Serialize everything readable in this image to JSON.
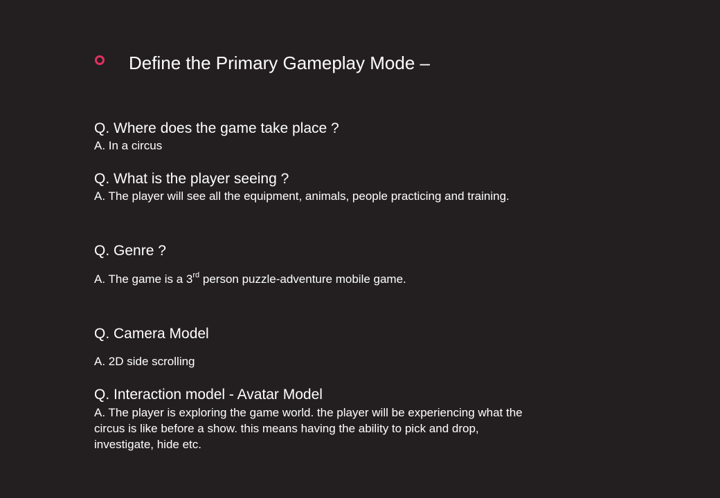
{
  "slide": {
    "accent_color": "#e0315e",
    "bullet_icon": "ring-bullet-icon",
    "title": "Define the Primary Gameplay Mode –",
    "qa": [
      {
        "question": "Q. Where does the game take place ?",
        "answer": "A. In a circus"
      },
      {
        "question": "Q. What is the player seeing ?",
        "answer": "A. The player will see all the equipment, animals, people practicing and training."
      },
      {
        "question": "Q. Genre ?",
        "answer_prefix": "A. The game is a 3",
        "answer_sup": "rd",
        "answer_suffix": " person puzzle-adventure mobile game."
      },
      {
        "question": "Q. Camera Model",
        "answer": "A. 2D side scrolling"
      },
      {
        "question": "Q. Interaction model - Avatar Model",
        "answer_lines": [
          "A. The player is exploring the game world. the player will be experiencing what the",
          "circus is like before a show. this means having the ability to pick and drop,",
          "investigate, hide etc."
        ]
      }
    ]
  }
}
